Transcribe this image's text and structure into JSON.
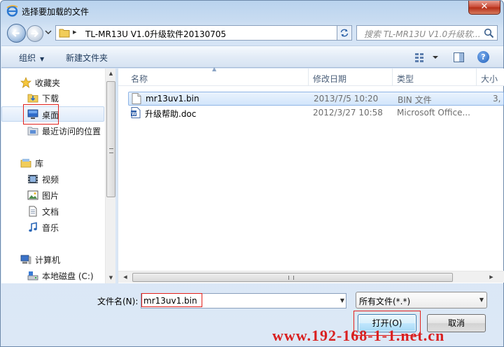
{
  "window": {
    "title": "选择要加载的文件",
    "close_label": "✕"
  },
  "address_bar": {
    "separator": "▸",
    "path": "TL-MR13U V1.0升级软件20130705"
  },
  "search": {
    "placeholder": "搜索 TL-MR13U V1.0升级软..."
  },
  "toolbar": {
    "organize_label": "组织",
    "new_folder_label": "新建文件夹",
    "help_label": "?"
  },
  "nav_pane": {
    "favorites_label": "收藏夹",
    "favorites": [
      {
        "label": "下载",
        "icon": "download-folder-icon"
      },
      {
        "label": "桌面",
        "icon": "desktop-icon",
        "highlighted": true
      },
      {
        "label": "最近访问的位置",
        "icon": "recent-places-icon"
      }
    ],
    "libraries_label": "库",
    "libraries": [
      {
        "label": "视频",
        "icon": "video-icon"
      },
      {
        "label": "图片",
        "icon": "pictures-icon"
      },
      {
        "label": "文档",
        "icon": "documents-icon"
      },
      {
        "label": "音乐",
        "icon": "music-icon"
      }
    ],
    "computer_label": "计算机",
    "computer": [
      {
        "label": "本地磁盘 (C:)",
        "icon": "local-disk-icon"
      }
    ]
  },
  "file_list": {
    "columns": [
      "名称",
      "修改日期",
      "类型",
      "大小"
    ],
    "rows": [
      {
        "name": "mr13uv1.bin",
        "date": "2013/7/5 10:20",
        "type": "BIN 文件",
        "size": "3,",
        "selected": true
      },
      {
        "name": "升级帮助.doc",
        "date": "2012/3/27 10:58",
        "type": "Microsoft Office...",
        "size": "",
        "selected": false
      }
    ]
  },
  "bottom": {
    "filename_label": "文件名(N):",
    "filename_value": "mr13uv1.bin",
    "filetype_value": "所有文件(*.*)",
    "open_label": "打开(O)",
    "cancel_label": "取消"
  },
  "watermark": "www.192-168-1-1.net.cn",
  "colors": {
    "highlight_box": "#e2211c",
    "selection": "#d2e5fb",
    "watermark": "#d92020"
  }
}
